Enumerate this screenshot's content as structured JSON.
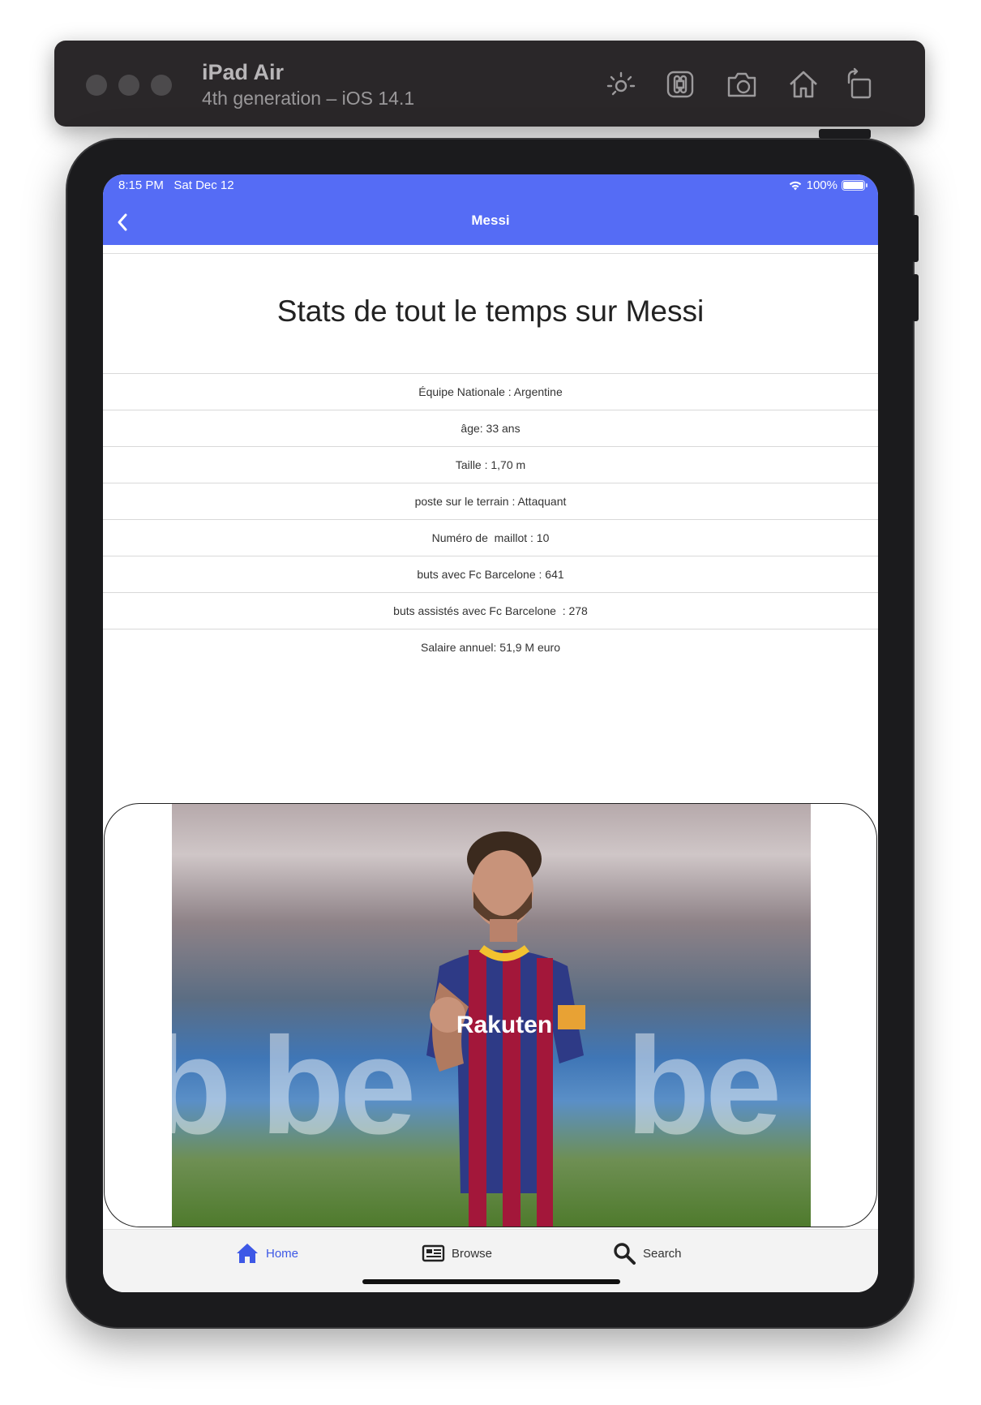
{
  "simulator": {
    "device_name": "iPad Air",
    "device_detail": "4th generation – iOS 14.1",
    "toolbar_icons": [
      "brightness-icon",
      "command-icon",
      "screenshot-icon",
      "home-icon",
      "rotate-icon"
    ]
  },
  "status_bar": {
    "time": "8:15 PM",
    "date": "Sat Dec 12",
    "battery": "100%",
    "battery_level": 1.0
  },
  "nav": {
    "title": "Messi",
    "back_icon": "chevron-left-icon"
  },
  "page": {
    "heading": "Stats de tout le temps sur Messi"
  },
  "stats": [
    "Équipe Nationale : Argentine",
    "âge: 33 ans",
    "Taille : 1,70 m",
    "poste sur le terrain : Attaquant",
    "Numéro de  maillot : 10",
    "buts avec Fc Barcelone : 641",
    "buts assistés avec Fc Barcelone  : 278",
    "Salaire annuel: 51,9 M euro"
  ],
  "photo": {
    "jersey_text": "Rakuten"
  },
  "tabs": [
    {
      "label": "Home",
      "icon": "home-icon",
      "active": true
    },
    {
      "label": "Browse",
      "icon": "newspaper-icon",
      "active": false
    },
    {
      "label": "Search",
      "icon": "search-icon",
      "active": false
    }
  ],
  "colors": {
    "accent": "#556cf5",
    "tab_active": "#3d58e6"
  }
}
